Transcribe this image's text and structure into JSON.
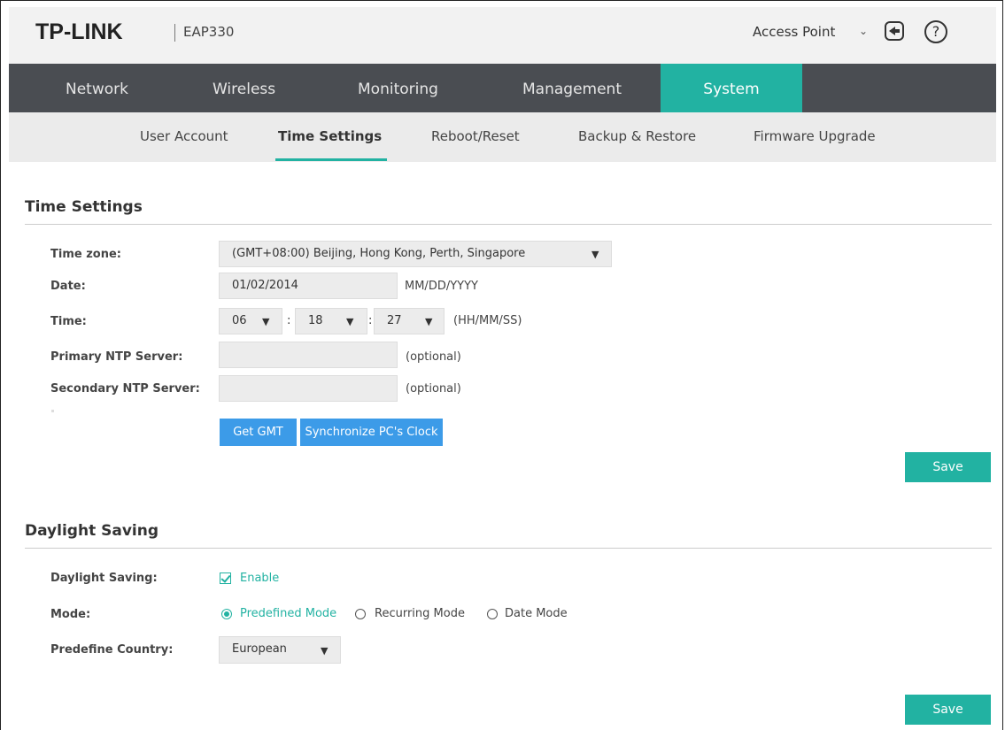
{
  "header": {
    "logo": "TP-LINK",
    "model": "EAP330",
    "mode_select": "Access Point",
    "icons": [
      "logout-icon",
      "help-icon"
    ]
  },
  "main_nav": {
    "tabs": [
      "Network",
      "Wireless",
      "Monitoring",
      "Management",
      "System"
    ],
    "active": "System"
  },
  "sub_nav": {
    "items": [
      "User Account",
      "Time Settings",
      "Reboot/Reset",
      "Backup & Restore",
      "Firmware Upgrade"
    ],
    "active": "Time Settings"
  },
  "time_settings": {
    "title": "Time Settings",
    "timezone_label": "Time zone:",
    "timezone_value": "(GMT+08:00) Beijing, Hong Kong, Perth, Singapore",
    "date_label": "Date:",
    "date_value": "01/02/2014",
    "date_hint": "MM/DD/YYYY",
    "time_label": "Time:",
    "hour": "06",
    "minute": "18",
    "second": "27",
    "time_sep": ":",
    "time_hint": "(HH/MM/SS)",
    "primary_ntp_label": "Primary NTP Server:",
    "primary_ntp_value": "",
    "primary_ntp_hint": "(optional)",
    "secondary_ntp_label": "Secondary NTP Server:",
    "secondary_ntp_value": "",
    "secondary_ntp_hint": "(optional)",
    "get_gmt_button": "Get GMT",
    "sync_button": "Synchronize PC's Clock",
    "save_button": "Save"
  },
  "daylight_saving": {
    "title": "Daylight Saving",
    "ds_label": "Daylight Saving:",
    "enable_label": "Enable",
    "enabled": true,
    "mode_label": "Mode:",
    "modes": [
      "Predefined Mode",
      "Recurring Mode",
      "Date Mode"
    ],
    "selected_mode": "Predefined Mode",
    "country_label": "Predefine Country:",
    "country_value": "European",
    "save_button": "Save"
  },
  "colors": {
    "accent": "#22b2a2",
    "nav_bg": "#4a4d52",
    "button_blue": "#3c9be8"
  }
}
